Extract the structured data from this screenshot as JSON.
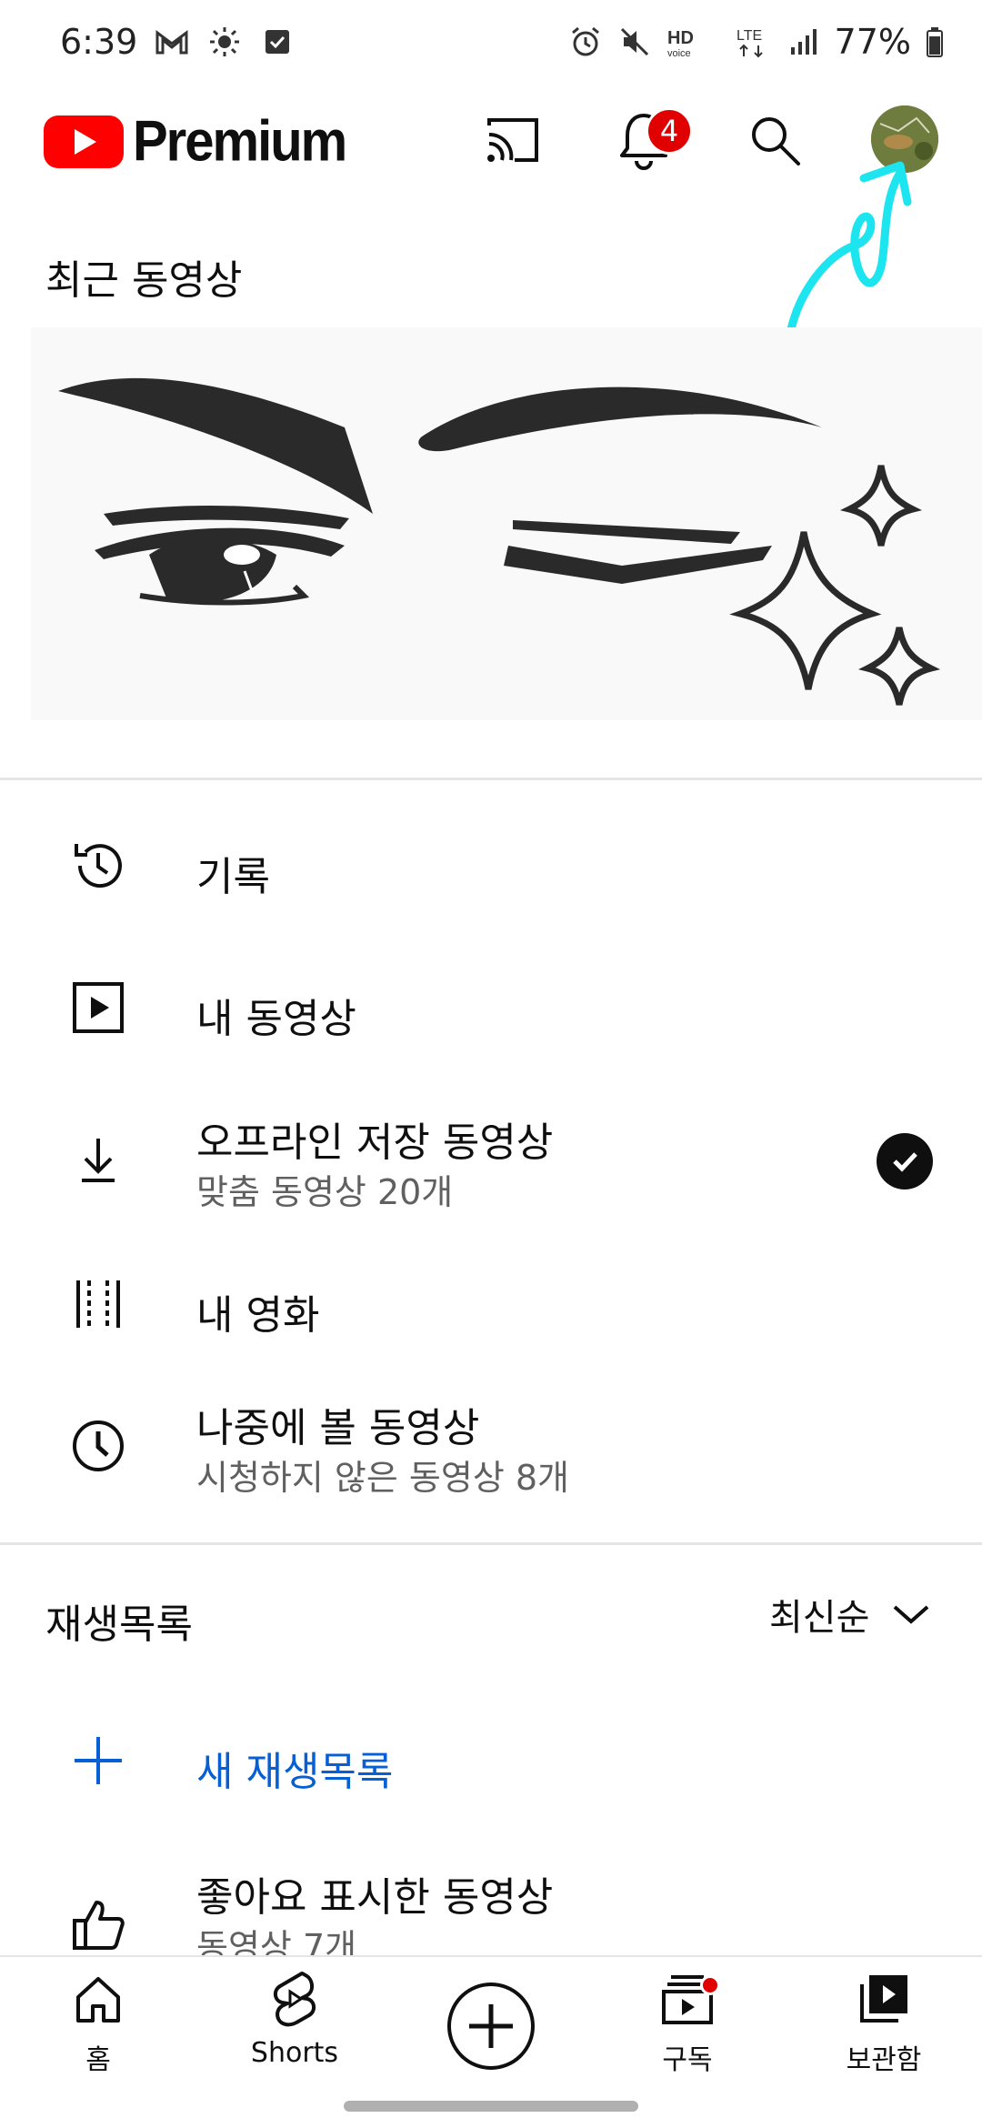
{
  "status_bar": {
    "time": "6:39",
    "battery": "77%"
  },
  "header": {
    "logo_text": "Premium",
    "notification_count": "4"
  },
  "recent": {
    "title": "최근 동영상"
  },
  "library": {
    "history": "기록",
    "my_videos": "내 동영상",
    "offline_title": "오프라인 저장 동영상",
    "offline_sub": "맞춤 동영상 20개",
    "my_movies": "내 영화",
    "watch_later_title": "나중에 볼 동영상",
    "watch_later_sub": "시청하지 않은 동영상 8개"
  },
  "playlists": {
    "title": "재생목록",
    "sort_label": "최신순",
    "new_playlist": "새 재생목록",
    "liked_title": "좋아요 표시한 동영상",
    "liked_sub": "동영상 7개"
  },
  "bottom_nav": {
    "home": "홈",
    "shorts": "Shorts",
    "subscriptions": "구독",
    "library": "보관함"
  },
  "colors": {
    "brand_red": "#ff0000",
    "link_blue": "#065fd4",
    "arrow_cyan": "#1de5f0"
  }
}
